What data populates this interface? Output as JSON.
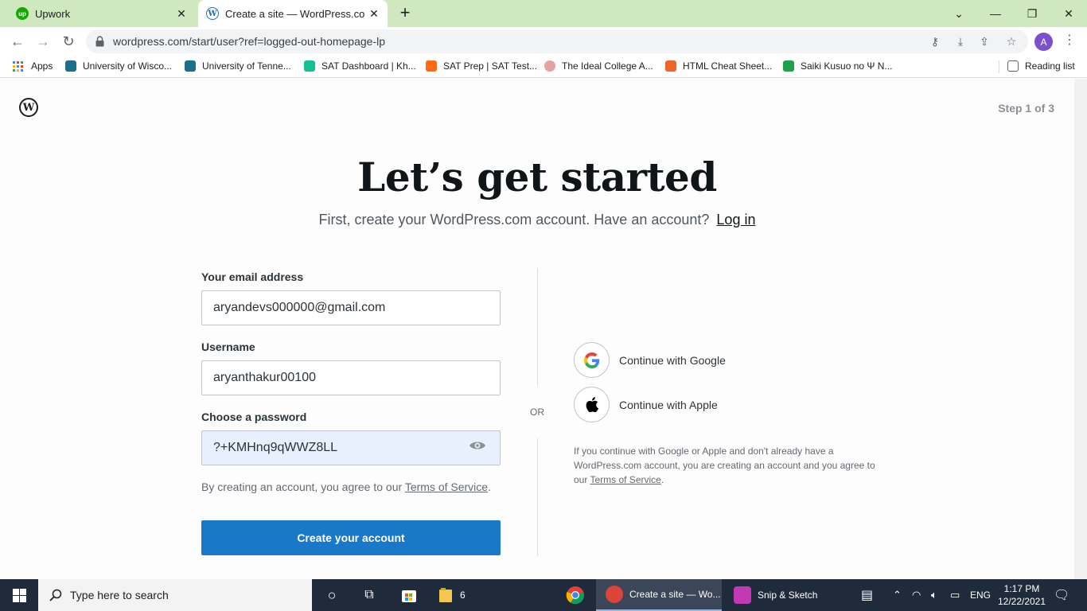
{
  "browser": {
    "tabs": [
      {
        "title": "Upwork",
        "favicon": "upwork-icon"
      },
      {
        "title": "Create a site — WordPress.com",
        "favicon": "wordpress-icon"
      }
    ],
    "url": "wordpress.com/start/user?ref=logged-out-homepage-lp",
    "profile_initial": "A",
    "bookmarks": [
      {
        "label": "Apps",
        "icon": "apps-grid-icon"
      },
      {
        "label": "University of Wisco...",
        "icon": "bookmark-favicon",
        "color": "#1a6f8a"
      },
      {
        "label": "University of Tenne...",
        "icon": "bookmark-favicon",
        "color": "#1a6f8a"
      },
      {
        "label": "SAT Dashboard | Kh...",
        "icon": "bookmark-favicon",
        "color": "#14bf96"
      },
      {
        "label": "SAT Prep | SAT Test...",
        "icon": "bookmark-favicon",
        "color": "#ff6a13"
      },
      {
        "label": "The Ideal College A...",
        "icon": "bookmark-favicon",
        "color": "#e8a0a0"
      },
      {
        "label": "HTML Cheat Sheet...",
        "icon": "bookmark-favicon",
        "color": "#f06529"
      },
      {
        "label": "Saiki Kusuo no Ψ N...",
        "icon": "bookmark-favicon",
        "color": "#1aa34a"
      }
    ],
    "reading_list": "Reading list"
  },
  "page": {
    "step": "Step 1 of 3",
    "heading": "Let’s get started",
    "subheading": "First, create your WordPress.com account. Have an account?",
    "login_link": "Log in",
    "form": {
      "email_label": "Your email address",
      "email_value": "aryandevs000000@gmail.com",
      "username_label": "Username",
      "username_value": "aryanthakur00100",
      "password_label": "Choose a password",
      "password_value": "?+KMHnq9qWWZ8LL",
      "terms_prefix": "By creating an account, you agree to our",
      "terms_link": "Terms of Service",
      "terms_suffix": ".",
      "submit_label": "Create your account"
    },
    "or_label": "OR",
    "social": {
      "google_label": "Continue with Google",
      "apple_label": "Continue with Apple",
      "note": "If you continue with Google or Apple and don't already have a WordPress.com account, you are creating an account and you agree to our",
      "note_link": "Terms of Service",
      "note_suffix": "."
    }
  },
  "taskbar": {
    "search_placeholder": "Type here to search",
    "file_explorer_count": "6",
    "chrome_window": "Create a site — Wo...",
    "snip_app": "Snip & Sketch",
    "language": "ENG",
    "time": "1:17 PM",
    "date": "12/22/2021"
  },
  "colors": {
    "titlebar": "#cfe8c0",
    "primary_button": "#1979c8",
    "taskbar": "#1f2a3b"
  }
}
